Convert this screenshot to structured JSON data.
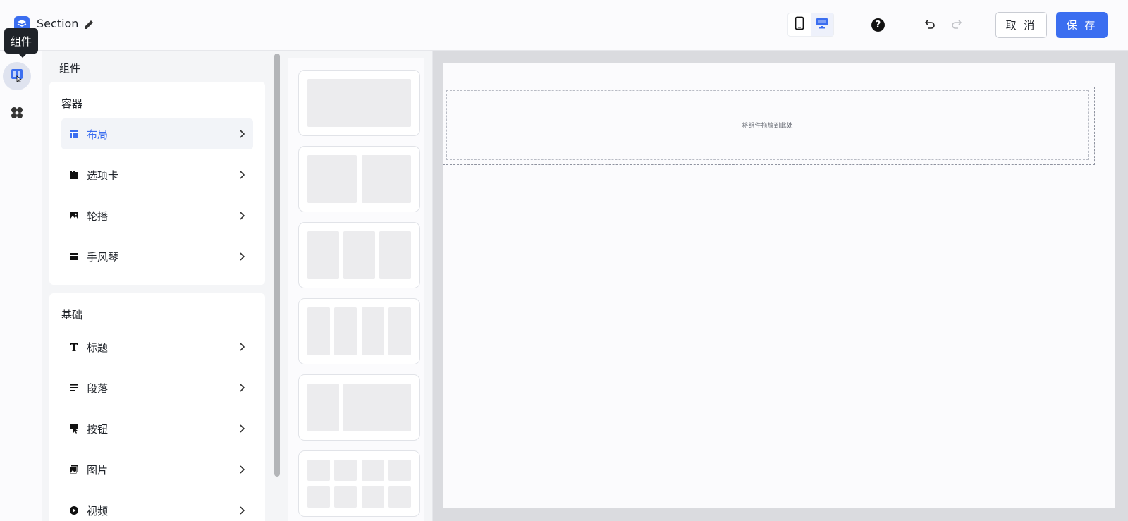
{
  "header": {
    "title": "Section",
    "cancel_label": "取 消",
    "save_label": "保 存",
    "help_glyph": "?",
    "icons": [
      "logo-icon",
      "edit-icon",
      "mobile-icon",
      "desktop-icon",
      "help-icon",
      "undo-icon",
      "redo-icon"
    ]
  },
  "rail": {
    "tooltip": "组件",
    "items": [
      "components-icon",
      "apps-icon"
    ]
  },
  "panel": {
    "title": "组件",
    "containers": {
      "title": "容器",
      "items": [
        {
          "label": "布局",
          "icon": "layout-icon",
          "active": true
        },
        {
          "label": "选项卡",
          "icon": "tabs-icon"
        },
        {
          "label": "轮播",
          "icon": "carousel-icon"
        },
        {
          "label": "手风琴",
          "icon": "accordion-icon"
        }
      ]
    },
    "basics": {
      "title": "基础",
      "items": [
        {
          "label": "标题",
          "icon": "heading-icon"
        },
        {
          "label": "段落",
          "icon": "paragraph-icon"
        },
        {
          "label": "按钮",
          "icon": "button-icon"
        },
        {
          "label": "图片",
          "icon": "image-icon"
        },
        {
          "label": "视频",
          "icon": "video-icon"
        }
      ]
    }
  },
  "presets": [
    "1-column",
    "2-columns",
    "3-columns",
    "4-columns",
    "1-2-columns",
    "4x2-grid"
  ],
  "canvas": {
    "drop_text": "将组件拖放到此处"
  },
  "colors": {
    "accent": "#3b6ef0",
    "text": "#1f2329",
    "panel_bg": "#f4f5f7"
  }
}
